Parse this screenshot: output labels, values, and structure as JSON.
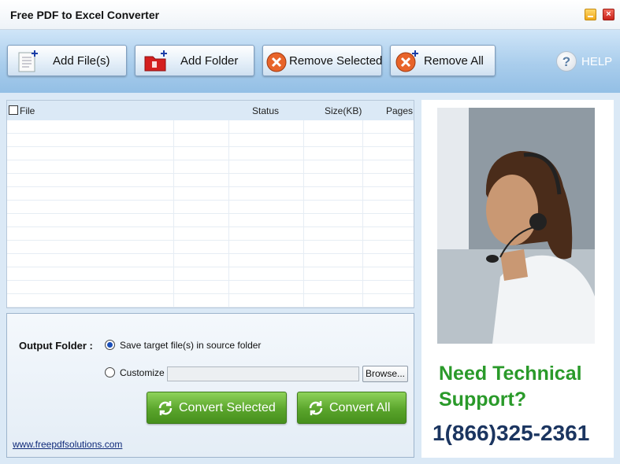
{
  "window": {
    "title": "Free PDF to Excel Converter",
    "close_glyph": "×"
  },
  "toolbar": {
    "add_files": "Add File(s)",
    "add_folder": "Add Folder",
    "remove_selected": "Remove Selected",
    "remove_all": "Remove All",
    "help": "HELP",
    "help_glyph": "?"
  },
  "file_list": {
    "columns": [
      "File",
      "Status",
      "Size(KB)",
      "Pages"
    ],
    "rows": []
  },
  "output": {
    "label": "Output Folder :",
    "option_source": "Save target file(s) in source folder",
    "option_customize": "Customize :",
    "custom_path": "",
    "browse": "Browse...",
    "convert_selected": "Convert Selected",
    "convert_all": "Convert All",
    "website": "www.freepdfsolutions.com"
  },
  "ad": {
    "headline": "Need Technical Support?",
    "phone": "1(866)325-2361"
  },
  "colors": {
    "accent_green": "#2a9a2a",
    "phone_blue": "#1b3560",
    "toolbar_blue": "#a9cdec"
  }
}
